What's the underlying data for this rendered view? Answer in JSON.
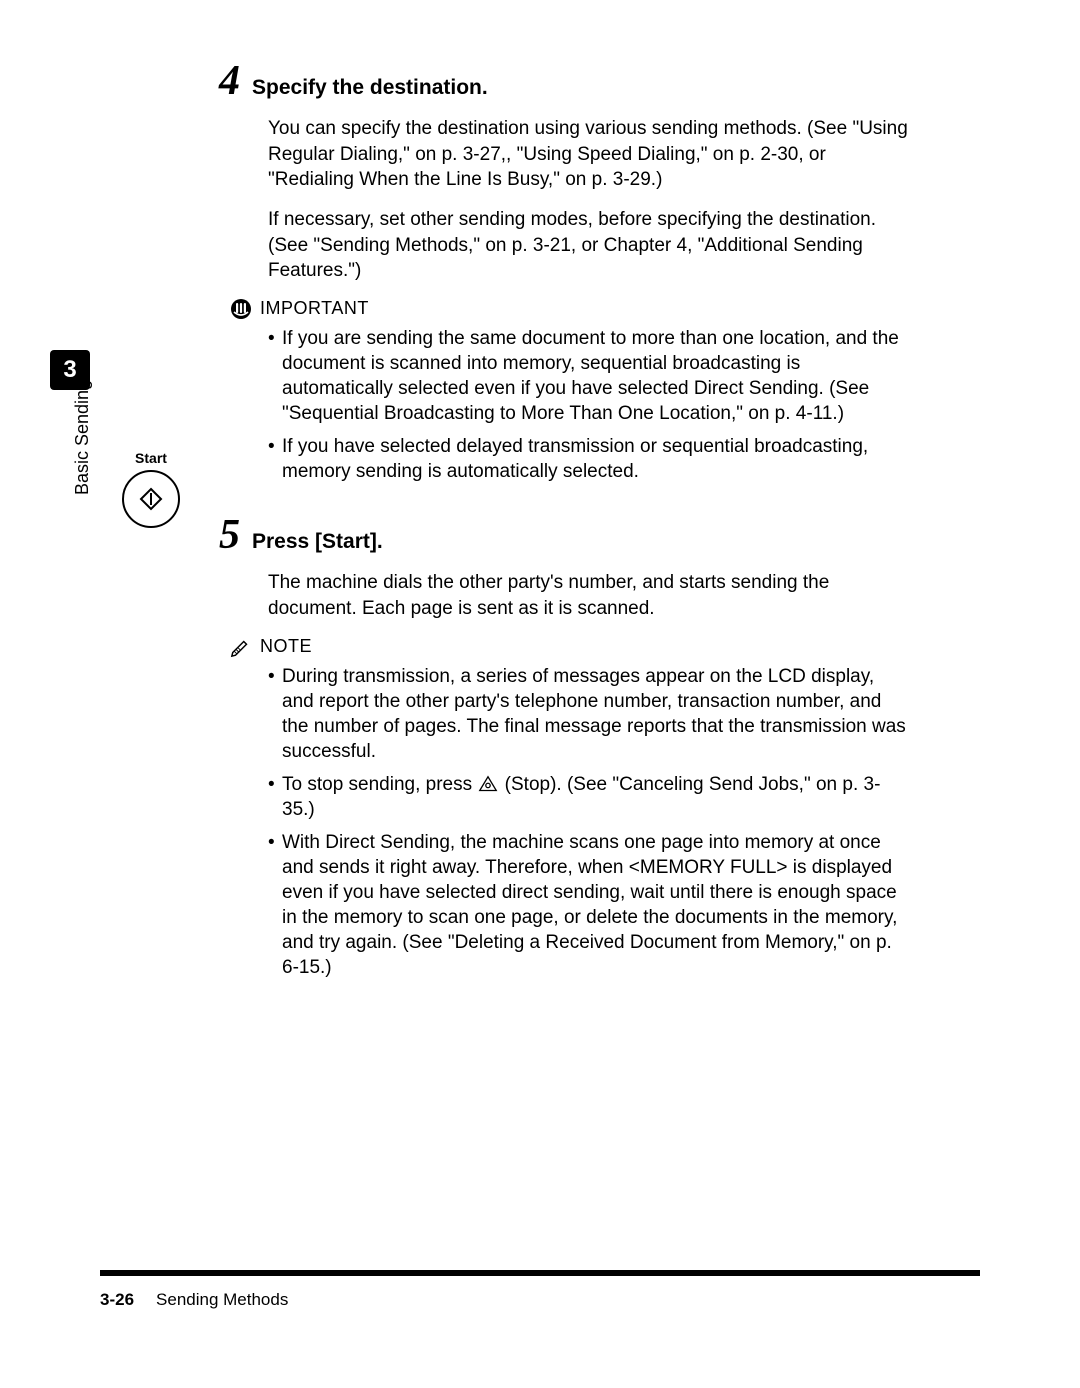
{
  "side": {
    "chapter_number": "3",
    "chapter_title": "Basic Sending"
  },
  "steps": [
    {
      "number": "4",
      "title": "Specify the destination.",
      "paragraphs": [
        "You can specify the destination using various sending methods. (See \"Using Regular Dialing,\" on p. 3-27,, \"Using Speed Dialing,\" on p. 2-30, or \"Redialing When the Line Is Busy,\" on p. 3-29.)",
        "If necessary, set other sending modes, before specifying the destination. (See \"Sending Methods,\" on p. 3-21, or Chapter 4, \"Additional Sending Features.\")"
      ],
      "callouts": [
        {
          "icon": "important-icon",
          "label": "IMPORTANT",
          "bullets": [
            "If you are sending the same document to more than one location, and the document is scanned into memory, sequential broadcasting is automatically selected even if you have selected Direct Sending. (See \"Sequential Broadcasting to More Than One Location,\" on p. 4-11.)",
            "If you have selected delayed transmission or sequential broadcasting, memory sending is automatically selected."
          ]
        }
      ]
    },
    {
      "number": "5",
      "title": "Press [Start].",
      "paragraphs": [
        "The machine dials the other party's number, and starts sending the document. Each page is sent as it is scanned."
      ],
      "callouts": [
        {
          "icon": "note-icon",
          "label": "NOTE",
          "bullets": [
            "During transmission, a series of messages appear on the LCD display, and report the other party's telephone number, transaction number, and the number of pages. The final message reports that the transmission was successful.",
            "To stop sending, press [STOP_ICON] (Stop). (See \"Canceling Send Jobs,\" on p. 3-35.)",
            "With Direct Sending, the machine scans one page into memory at once and sends it right away. Therefore, when <MEMORY FULL> is displayed even if you have selected direct sending, wait until there is enough space in the memory to scan one page, or delete the documents in the memory, and try again. (See \"Deleting a Received Document from Memory,\" on p. 6-15.)"
          ]
        }
      ]
    }
  ],
  "start_button": {
    "label": "Start"
  },
  "footer": {
    "page": "3-26",
    "section": "Sending Methods"
  }
}
